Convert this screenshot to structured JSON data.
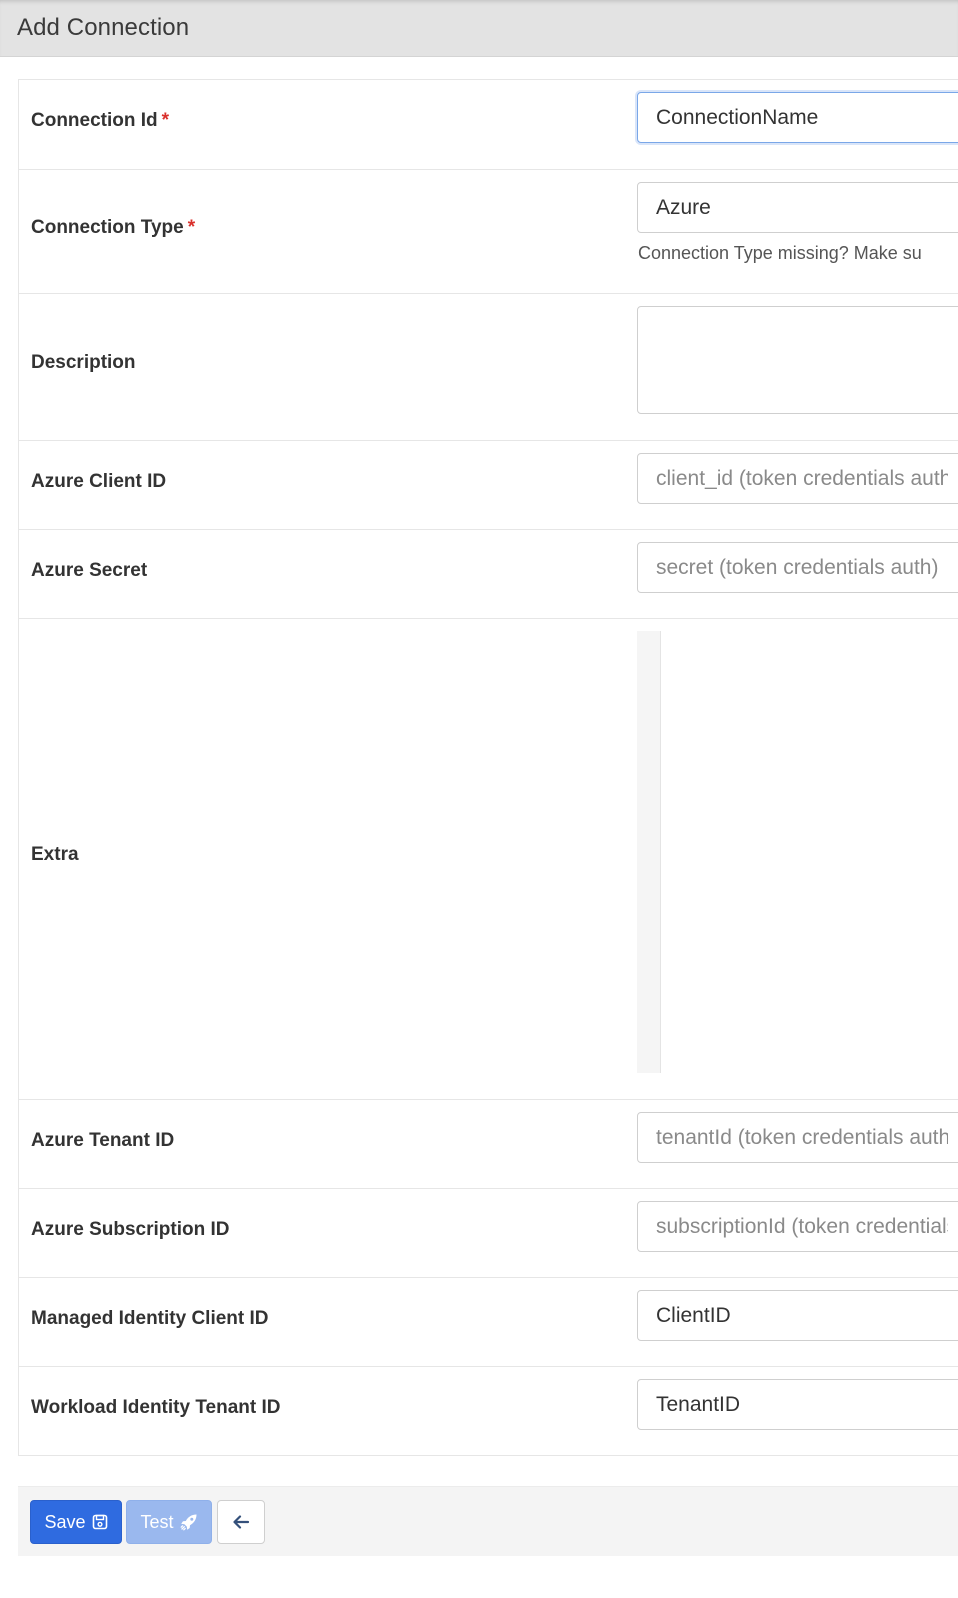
{
  "header": {
    "title": "Add Connection"
  },
  "fields": {
    "conn_id": {
      "label": "Connection Id",
      "required_mark": "*",
      "value": "ConnectionName"
    },
    "conn_type": {
      "label": "Connection Type",
      "required_mark": "*",
      "value": "Azure",
      "help": "Connection Type missing? Make su"
    },
    "description": {
      "label": "Description",
      "value": ""
    },
    "azure_client_id": {
      "label": "Azure Client ID",
      "placeholder": "client_id (token credentials auth)"
    },
    "azure_secret": {
      "label": "Azure Secret",
      "placeholder": "secret (token credentials auth)"
    },
    "extra": {
      "label": "Extra"
    },
    "azure_tenant_id": {
      "label": "Azure Tenant ID",
      "placeholder": "tenantId (token credentials auth)"
    },
    "azure_subscription_id": {
      "label": "Azure Subscription ID",
      "placeholder": "subscriptionId (token credentials auth)"
    },
    "managed_identity_client_id": {
      "label": "Managed Identity Client ID",
      "value": "ClientID"
    },
    "workload_identity_tenant_id": {
      "label": "Workload Identity Tenant ID",
      "value": "TenantID"
    }
  },
  "footer": {
    "save_label": "Save",
    "test_label": "Test",
    "save_icon": "floppy-disk-icon",
    "test_icon": "rocket-icon",
    "back_icon": "arrow-left-icon"
  },
  "colors": {
    "primary": "#2f6be0",
    "primary_disabled": "#9ab8ee",
    "required": "#d9302c",
    "focus_border": "#7aa7e8"
  }
}
